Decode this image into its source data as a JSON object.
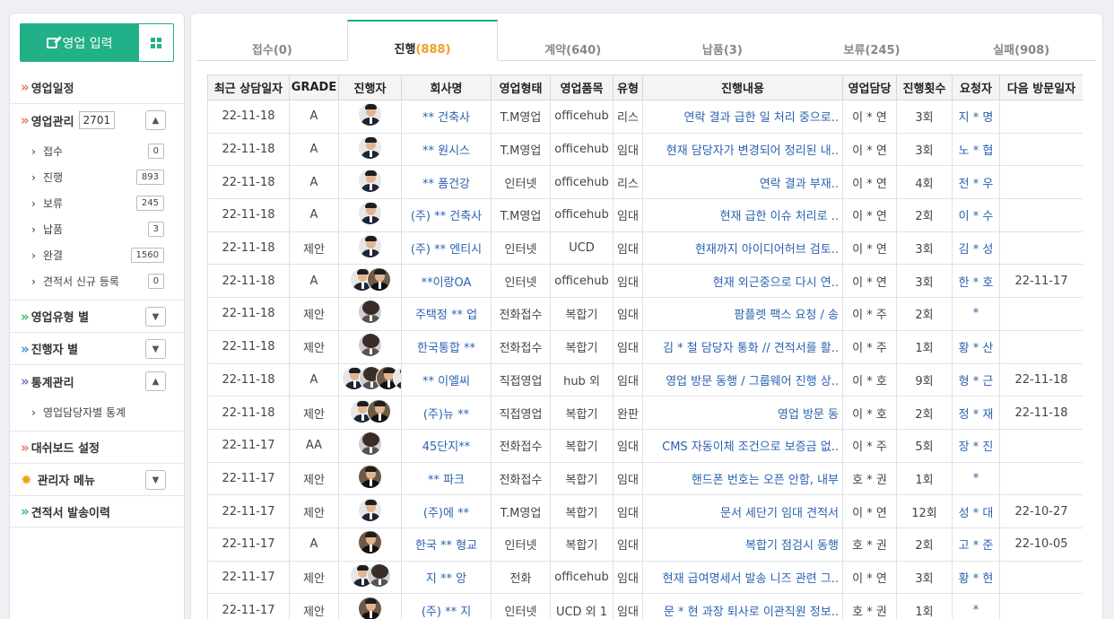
{
  "sidebar": {
    "input_button": "영업 입력",
    "menu": {
      "schedule": "영업일정",
      "management": "영업관리",
      "management_count": "2701",
      "sub": [
        {
          "label": "접수",
          "count": "0"
        },
        {
          "label": "진행",
          "count": "893"
        },
        {
          "label": "보류",
          "count": "245"
        },
        {
          "label": "납품",
          "count": "3"
        },
        {
          "label": "완결",
          "count": "1560"
        },
        {
          "label": "견적서 신규 등록",
          "count": "0"
        }
      ],
      "by_type": "영업유형 별",
      "by_owner": "진행자 별",
      "stats": "통계관리",
      "stats_sub": "영업담당자별 통계",
      "dashboard": "대쉬보드 설정",
      "admin": "관리자 메뉴",
      "quote_history": "견적서 발송이력"
    }
  },
  "tabs": [
    {
      "label": "접수",
      "count": "(0)"
    },
    {
      "label": "진행",
      "count": "(888)"
    },
    {
      "label": "계약",
      "count": "(640)"
    },
    {
      "label": "납품",
      "count": "(3)"
    },
    {
      "label": "보류",
      "count": "(245)"
    },
    {
      "label": "실패",
      "count": "(908)"
    }
  ],
  "table": {
    "headers": [
      "최근 상담일자",
      "GRADE",
      "진행자",
      "회사명",
      "영업형태",
      "영업품목",
      "유형",
      "진행내용",
      "영업담당",
      "진행횟수",
      "요청자",
      "다음 방문일자"
    ],
    "rows": [
      {
        "date": "22-11-18",
        "grade": "A",
        "av": "m",
        "company": "** 건축사",
        "form": "T.M영업",
        "item": "officehub",
        "type": "리스",
        "content": "연락 결과 급한 일 처리 중으로..",
        "rep": "이 * 연",
        "count": "3회",
        "req": "지 * 명",
        "next": ""
      },
      {
        "date": "22-11-18",
        "grade": "A",
        "av": "m",
        "company": "** 원시스",
        "form": "T.M영업",
        "item": "officehub",
        "type": "임대",
        "content": "현재 담당자가 변경되어 정리된 내..",
        "rep": "이 * 연",
        "count": "3회",
        "req": "노 * 협",
        "next": ""
      },
      {
        "date": "22-11-18",
        "grade": "A",
        "av": "m",
        "company": "** 폼건강",
        "form": "인터넷",
        "item": "officehub",
        "type": "리스",
        "content": "연락 결과 부재..",
        "rep": "이 * 연",
        "count": "4회",
        "req": "전 * 우",
        "next": ""
      },
      {
        "date": "22-11-18",
        "grade": "A",
        "av": "m",
        "company": "(주) ** 건축사",
        "form": "T.M영업",
        "item": "officehub",
        "type": "임대",
        "content": "현재 급한 이슈 처리로 ..",
        "rep": "이 * 연",
        "count": "2회",
        "req": "이 * 수",
        "next": ""
      },
      {
        "date": "22-11-18",
        "grade": "제안",
        "av": "m",
        "company": "(주) ** 엔티시",
        "form": "인터넷",
        "item": "UCD",
        "type": "임대",
        "content": "현재까지 아이디어허브 검토..",
        "rep": "이 * 연",
        "count": "3회",
        "req": "김 * 성",
        "next": ""
      },
      {
        "date": "22-11-18",
        "grade": "A",
        "av": "md",
        "company": "**이랑OA",
        "form": "인터넷",
        "item": "officehub",
        "type": "임대",
        "content": "현재 외근중으로 다시 연..",
        "rep": "이 * 연",
        "count": "3회",
        "req": "한 * 호",
        "next": "22-11-17"
      },
      {
        "date": "22-11-18",
        "grade": "제안",
        "av": "f",
        "company": "주택정 ** 업",
        "form": "전화접수",
        "item": "복합기",
        "type": "임대",
        "content": "팜플렛 팩스 요청 / 송",
        "rep": "이 * 주",
        "count": "2회",
        "req": "*",
        "next": ""
      },
      {
        "date": "22-11-18",
        "grade": "제안",
        "av": "f",
        "company": "한국통합 **",
        "form": "전화접수",
        "item": "복합기",
        "type": "임대",
        "content": "김 * 철 담당자 통화 // 견적서를 활..",
        "rep": "이 * 주",
        "count": "1회",
        "req": "황 * 산",
        "next": ""
      },
      {
        "date": "22-11-18",
        "grade": "A",
        "av": "mfdm",
        "company": "** 이엘씨",
        "form": "직접영업",
        "item": "hub 외",
        "type": "임대",
        "content": "영업 방문 동행 / 그룹웨어 진행 상..",
        "rep": "이 * 호",
        "count": "9회",
        "req": "형 * 근",
        "next": "22-11-18"
      },
      {
        "date": "22-11-18",
        "grade": "제안",
        "av": "md",
        "company": "(주)뉴 **",
        "form": "직접영업",
        "item": "복합기",
        "type": "완판",
        "content": "영업 방문 동",
        "rep": "이 * 호",
        "count": "2회",
        "req": "정 * 재",
        "next": "22-11-18"
      },
      {
        "date": "22-11-17",
        "grade": "AA",
        "av": "f",
        "company": "45단지**",
        "form": "전화접수",
        "item": "복합기",
        "type": "임대",
        "content": "CMS 자동이체 조건으로 보증금 없..",
        "rep": "이 * 주",
        "count": "5회",
        "req": "장 * 진",
        "next": ""
      },
      {
        "date": "22-11-17",
        "grade": "제안",
        "av": "d",
        "company": "** 파크",
        "form": "전화접수",
        "item": "복합기",
        "type": "임대",
        "content": "핸드폰 번호는 오픈 안함, 내부",
        "rep": "호 * 권",
        "count": "1회",
        "req": "*",
        "next": ""
      },
      {
        "date": "22-11-17",
        "grade": "제안",
        "av": "m",
        "company": "(주)에 **",
        "form": "T.M영업",
        "item": "복합기",
        "type": "임대",
        "content": "문서 세단기 임대 견적서",
        "rep": "이 * 연",
        "count": "12회",
        "req": "성 * 대",
        "next": "22-10-27"
      },
      {
        "date": "22-11-17",
        "grade": "A",
        "av": "d",
        "company": "한국 ** 형교",
        "form": "인터넷",
        "item": "복합기",
        "type": "임대",
        "content": "복합기 점검시 동행",
        "rep": "호 * 권",
        "count": "2회",
        "req": "고 * 준",
        "next": "22-10-05"
      },
      {
        "date": "22-11-17",
        "grade": "제안",
        "av": "mf",
        "company": "지 ** 앙",
        "form": "전화",
        "item": "officehub",
        "type": "임대",
        "content": "현재 급여명세서 발송 니즈 관련 그..",
        "rep": "이 * 연",
        "count": "3회",
        "req": "황 * 현",
        "next": ""
      },
      {
        "date": "22-11-17",
        "grade": "제안",
        "av": "d",
        "company": "(주) ** 지",
        "form": "인터넷",
        "item": "UCD 외 1",
        "type": "임대",
        "content": "문 * 현 과장 퇴사로 이관직원 정보..",
        "rep": "호 * 권",
        "count": "1회",
        "req": "*",
        "next": ""
      }
    ]
  }
}
